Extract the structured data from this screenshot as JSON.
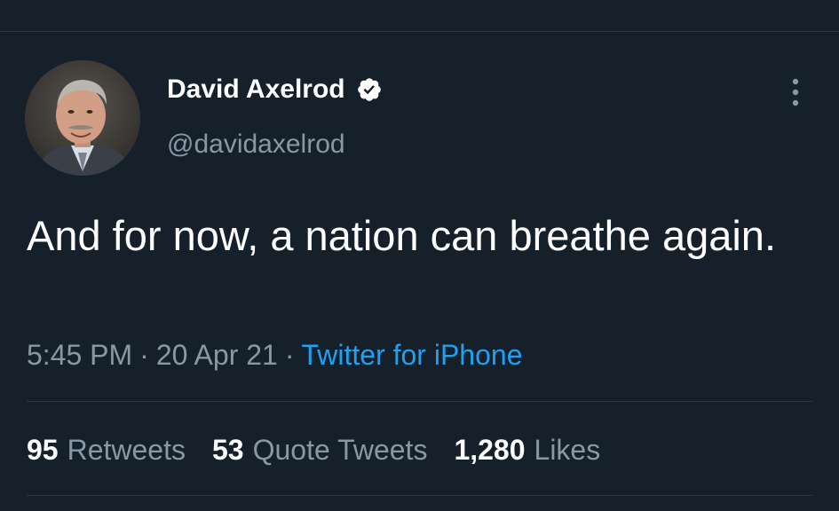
{
  "author": {
    "display_name": "David Axelrod",
    "handle": "@davidaxelrod"
  },
  "icons": {
    "verified": "verified-badge-icon",
    "more": "more-vertical-icon"
  },
  "tweet": {
    "text": "And for now, a nation can breathe again.",
    "time": "5:45 PM",
    "separator": "·",
    "date": "20 Apr 21",
    "source": "Twitter for iPhone"
  },
  "stats": {
    "retweets_count": "95",
    "retweets_label": "Retweets",
    "quotes_count": "53",
    "quotes_label": "Quote Tweets",
    "likes_count": "1,280",
    "likes_label": "Likes"
  },
  "colors": {
    "background": "#15202b",
    "primary_text": "#ffffff",
    "secondary_text": "#8899a6",
    "accent": "#1da1f2"
  }
}
